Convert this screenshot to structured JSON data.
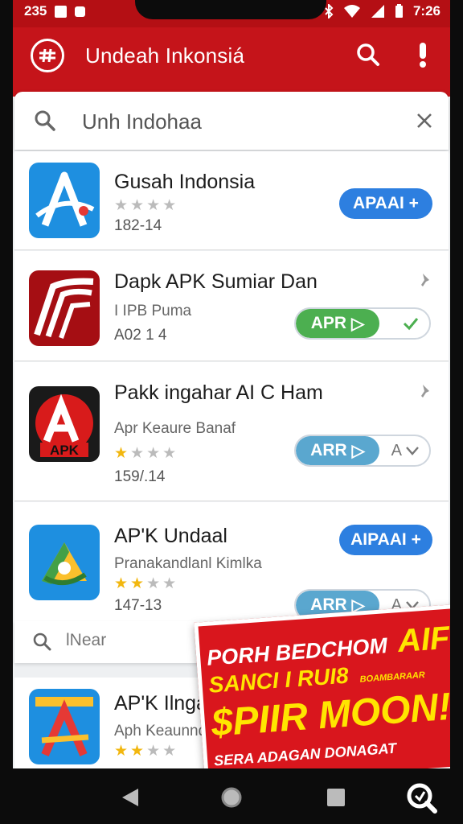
{
  "status_bar": {
    "left_time": "235",
    "right_time": "7:26"
  },
  "app_bar": {
    "title": "Undeah Inkonsiá"
  },
  "search": {
    "query": "Unh Indohaa"
  },
  "apps": [
    {
      "name": "Gusah Indonsia",
      "stars": 0,
      "meta": "182-14",
      "action": "APAAI +"
    },
    {
      "name": "Dapk APK Sumiar Dan",
      "subtitle": "I IPB Puma",
      "meta": "A02 1 4",
      "action": "APR",
      "toggle": true,
      "toggle_color": "#4caf50"
    },
    {
      "name": "Pakk ingahar AI C Ham",
      "subtitle": "Apr Keaure Banaf",
      "stars": 1,
      "meta": "159/.14",
      "action": "ARR",
      "action_right": "A",
      "toggle": true,
      "toggle_color": "#5aa7cf"
    },
    {
      "name": "AP'K Undaal",
      "subtitle": "Pranakandlanl Kimlka",
      "stars": 2,
      "meta": "147-13",
      "action": "AIPAAI +",
      "action2": "ARR",
      "action2_right": "A"
    },
    {
      "name": "AP'K Ilngal",
      "subtitle": "Aph Keaunndal",
      "stars": 2
    }
  ],
  "search2": {
    "text": "lNear"
  },
  "promo": {
    "line1": "PORH BEDCHOM",
    "line1b": "AIFI",
    "line2": "SANCI I RUI8",
    "line2b": "BOAMBARAAR",
    "line3": "$PIIR MOON!",
    "line4": "SERA ADAGAN DONAGAT"
  },
  "colors": {
    "brand_red": "#c5141a",
    "blue": "#2d7fe0",
    "green": "#4caf50",
    "light_blue": "#5aa7cf"
  },
  "icons": [
    "apps-logo-icon",
    "search-icon",
    "alert-icon",
    "close-icon",
    "pin-icon",
    "back-icon",
    "home-icon",
    "recents-icon",
    "assistant-icon"
  ]
}
